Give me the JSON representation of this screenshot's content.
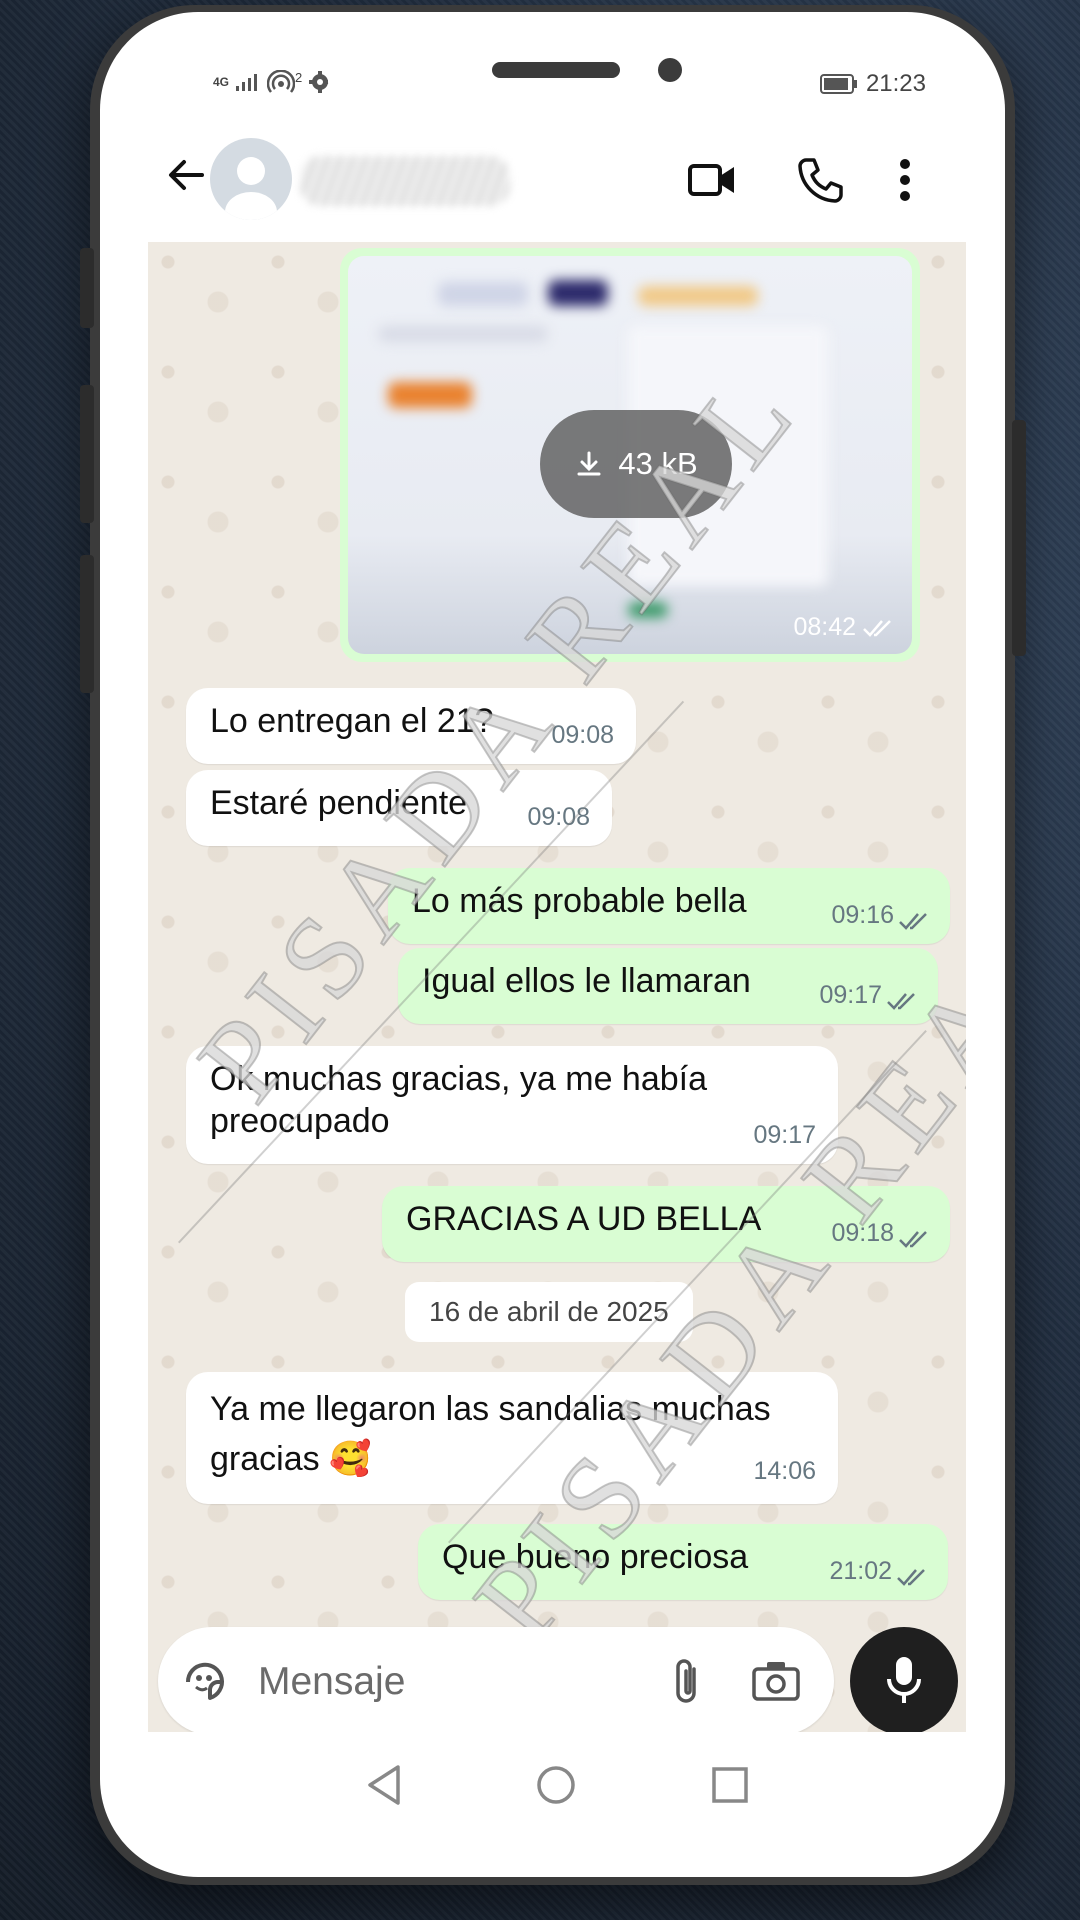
{
  "status_bar": {
    "network": "4G",
    "hotspot_count": "2",
    "time": "21:23"
  },
  "header": {
    "contact_name": "",
    "back_icon": "arrow-left-icon",
    "video_icon": "video-camera-icon",
    "call_icon": "phone-icon",
    "menu_icon": "more-vertical-icon"
  },
  "messages": [
    {
      "type": "image",
      "direction": "out",
      "size": "43 kB",
      "time": "08:42"
    },
    {
      "type": "text",
      "direction": "in",
      "text": "Lo entregan el 21?",
      "time": "09:08"
    },
    {
      "type": "text",
      "direction": "in",
      "text": "Estaré pendiente",
      "time": "09:08"
    },
    {
      "type": "text",
      "direction": "out",
      "text": "Lo más probable bella",
      "time": "09:16"
    },
    {
      "type": "text",
      "direction": "out",
      "text": "Igual ellos le llamaran",
      "time": "09:17"
    },
    {
      "type": "text",
      "direction": "in",
      "text": "Ok muchas gracias, ya me había preocupado",
      "time": "09:17"
    },
    {
      "type": "text",
      "direction": "out",
      "text": "GRACIAS A UD BELLA",
      "time": "09:18"
    },
    {
      "type": "text",
      "direction": "in",
      "text": "Ya me llegaron las sandalias muchas gracias 🥰",
      "time": "14:06"
    },
    {
      "type": "text",
      "direction": "out",
      "text": "Que bueno preciosa",
      "time": "21:02"
    }
  ],
  "date_separator": "16 de abril de 2025",
  "input": {
    "placeholder": "Mensaje",
    "sticker_icon": "sticker-icon",
    "attach_icon": "paperclip-icon",
    "camera_icon": "camera-icon",
    "mic_icon": "microphone-icon"
  },
  "watermark": {
    "text": "PISADA REAL"
  },
  "colors": {
    "outgoing_bubble": "#d9fdd3",
    "incoming_bubble": "#ffffff",
    "chat_background": "#efeae2",
    "mic_button": "#1f1f1f"
  }
}
